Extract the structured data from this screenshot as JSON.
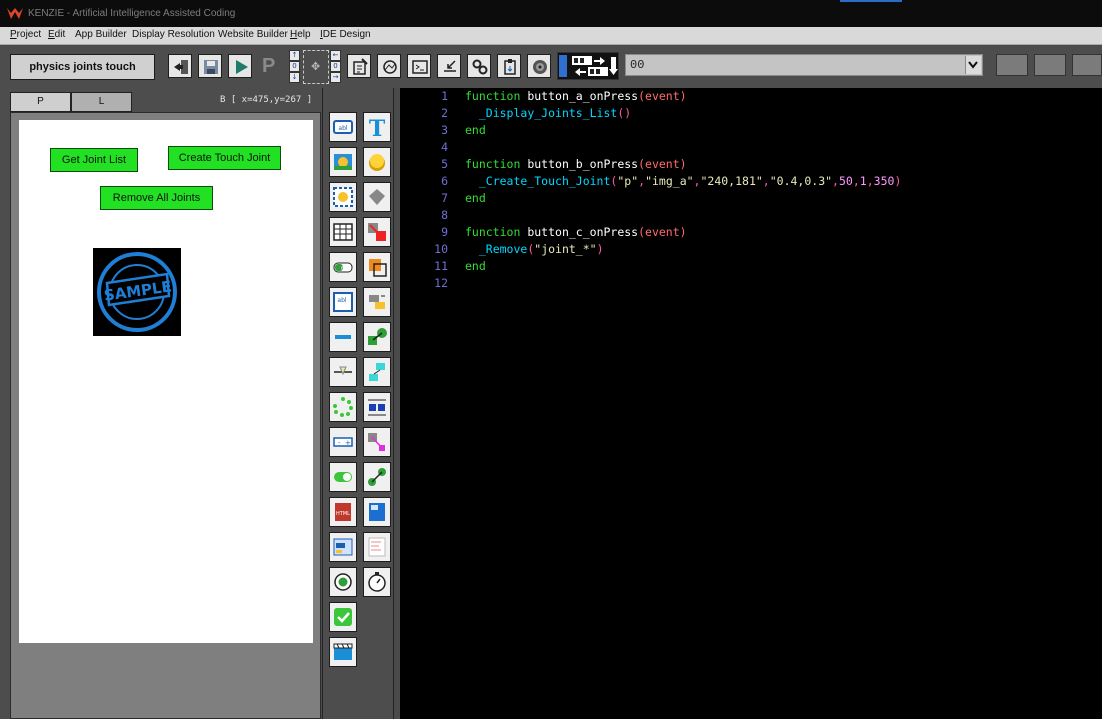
{
  "window": {
    "title": "KENZIE - Artificial Intelligence Assisted Coding"
  },
  "menu": [
    {
      "label": "Project",
      "u": "P",
      "rest": "roject"
    },
    {
      "label": "Edit",
      "u": "E",
      "rest": "dit"
    },
    {
      "label": "App Builder",
      "u": "",
      "rest": "App Builder"
    },
    {
      "label": "Display Resolution",
      "u": "",
      "rest": "Display Resolution"
    },
    {
      "label": "Website Builder",
      "u": "",
      "rest": "Website Builder"
    },
    {
      "label": "Help",
      "u": "H",
      "rest": "elp"
    },
    {
      "label": "IDE Design",
      "u": "I",
      "rest": "DE Design"
    }
  ],
  "toolbar": {
    "project_name": "physics joints touch",
    "p_letter": "P",
    "combo_value": "00"
  },
  "left_panel": {
    "tabs": [
      "P",
      "L"
    ],
    "coords": "B [ x=475,y=267 ]"
  },
  "canvas": {
    "buttons": {
      "get_joint_list": "Get Joint List",
      "create_touch_joint": "Create Touch Joint",
      "remove_all_joints": "Remove All Joints"
    },
    "stamp_text": "SAMPLE"
  },
  "code": {
    "line_numbers": [
      "1",
      "2",
      "3",
      "4",
      "5",
      "6",
      "7",
      "8",
      "9",
      "10",
      "11",
      "12"
    ],
    "tokens": {
      "function": "function",
      "end": "end",
      "fa": "button_a_onPress",
      "fb": "button_b_onPress",
      "fc": "button_c_onPress",
      "event": "(event)",
      "call_a": "_Display_Joints_List",
      "call_b": "_Create_Touch_Joint",
      "call_c": "_Remove",
      "args_a": "()",
      "lp": "(",
      "rp": ")",
      "comma": ",",
      "s_p": "\"p\"",
      "s_img": "\"img_a\"",
      "s_xy": "\"240,181\"",
      "s_scale": "\"0.4,0.3\"",
      "n1": "50",
      "n2": "1",
      "n3": "350",
      "s_joint": "\"joint_*\""
    }
  },
  "colors": {
    "editor_bg": "#000000",
    "keyword": "#33dd33",
    "line_number": "#6f6fd6",
    "green_button": "#22e022",
    "stamp_blue": "#1f7fd6"
  },
  "icons": {
    "toolbar": [
      "exit-icon",
      "save-icon",
      "play-icon",
      "properties-icon",
      "refresh-icon",
      "terminal-icon",
      "import-icon",
      "settings-icon",
      "clipboard-icon",
      "speaker-icon",
      "swap-icon",
      "download-icon"
    ],
    "palette": [
      "label-widget-icon",
      "text-tool-icon",
      "image-widget-icon",
      "button-widget-icon",
      "sprite-widget-icon",
      "shape-widget-icon",
      "grid-widget-icon",
      "remove-joint-icon",
      "progress-widget-icon",
      "layer-widget-icon",
      "textbox-widget-icon",
      "align-widget-icon",
      "slider-widget-icon",
      "joint-widget-icon",
      "pin-widget-icon",
      "tree-widget-icon",
      "spinner-widget-icon",
      "distance-joint-icon",
      "stepper-widget-icon",
      "rope-joint-icon",
      "toggle-widget-icon",
      "weld-joint-icon",
      "html-widget-icon",
      "map-widget-icon",
      "form-widget-icon",
      "list-widget-icon",
      "radio-widget-icon",
      "timer-widget-icon",
      "checkbox-widget-icon",
      "video-widget-icon"
    ]
  }
}
